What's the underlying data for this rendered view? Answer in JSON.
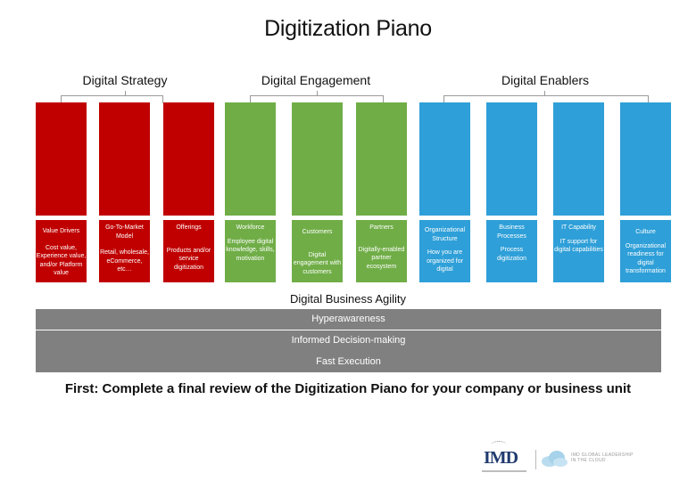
{
  "title": "Digitization Piano",
  "colors": {
    "strategy": "#c00000",
    "engagement": "#70ad47",
    "enablers": "#2e9fd8",
    "agility_bar": "#808080"
  },
  "groups": [
    {
      "label": "Digital Strategy",
      "color": "red",
      "keys": [
        {
          "heading": "Value Drivers",
          "detail": "Cost value, Experience value, and/or Platform value"
        },
        {
          "heading": "Go-To-Market Model",
          "detail": "Retail, wholesale, eCommerce, etc…"
        },
        {
          "heading": "Offerings",
          "detail": "Products and/or service digitization"
        }
      ]
    },
    {
      "label": "Digital Engagement",
      "color": "green",
      "keys": [
        {
          "heading": "Workforce",
          "detail": "Employee digital knowledge, skills, motivation"
        },
        {
          "heading": "Customers",
          "detail": "Digital engagement with customers"
        },
        {
          "heading": "Partners",
          "detail": "Digitally-enabled partner ecosystem"
        }
      ]
    },
    {
      "label": "Digital Enablers",
      "color": "blue",
      "keys": [
        {
          "heading": "Organizational Structure",
          "detail": "How you are organized for digital"
        },
        {
          "heading": "Business Processes",
          "detail": "Process digitization"
        },
        {
          "heading": "IT Capability",
          "detail": "IT support for digital capabilities"
        },
        {
          "heading": "Culture",
          "detail": "Organizational readiness for digital transformation"
        }
      ]
    }
  ],
  "agility": {
    "label": "Digital Business Agility",
    "items": [
      "Hyperawareness",
      "Informed Decision-making",
      "Fast Execution"
    ]
  },
  "footer_note": "First: Complete a final review of the Digitization Piano for your company or business unit",
  "logo": {
    "brand": "IMD",
    "tagline_line1": "IMD GLOBAL LEADERSHIP",
    "tagline_line2": "IN THE CLOUD"
  }
}
